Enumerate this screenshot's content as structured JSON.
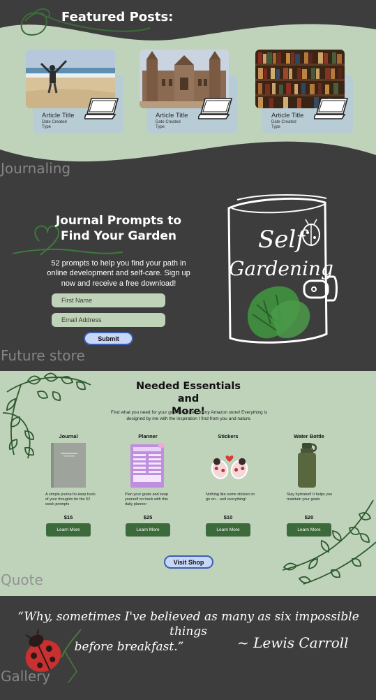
{
  "featured": {
    "title": "Featured Posts:",
    "posts": [
      {
        "title": "Article Title",
        "date": "Date Created",
        "type": "Type"
      },
      {
        "title": "Article Title",
        "date": "Date Created",
        "type": "Type"
      },
      {
        "title": "Article Title",
        "date": "Date Created",
        "type": "Type"
      }
    ]
  },
  "journaling": {
    "section_label": "Journaling",
    "title_line1": "Journal Prompts to",
    "title_line2": "Find Your Garden",
    "description": "52 prompts to help you find your path in online development and self-care. Sign up now and receive a free download!",
    "first_name_placeholder": "First Name",
    "email_placeholder": "Email Address",
    "submit_label": "Submit",
    "book_line1": "Self",
    "book_line2": "Gardening"
  },
  "store": {
    "section_label": "Future store",
    "title_line1": "Needed Essentials and",
    "title_line2": "More!",
    "description": "Find what you need for your growth located in my Amazon store! Everything is designed by me with the inspiration I find from you and nature.",
    "products": [
      {
        "name": "Journal",
        "description": "A simple journal to keep track of your thoughts for the 52 week prompts",
        "price": "$15",
        "button": "Learn More"
      },
      {
        "name": "Planner",
        "description": "Plan your goals and keep yourself on track with this daily planner",
        "price": "$25",
        "button": "Learn More"
      },
      {
        "name": "Stickers",
        "description": "Nothing like some stickers to go on... well everything!",
        "price": "$10",
        "button": "Learn More"
      },
      {
        "name": "Water Bottle",
        "description": "Stay hydrated! It helps you maintain your goals",
        "price": "$20",
        "button": "Learn More"
      }
    ],
    "visit_label": "Visit Shop"
  },
  "quote": {
    "section_label": "Quote",
    "text_line1": "“Why, sometimes I've believed as many as six impossible things",
    "text_line2": "before breakfast.”",
    "author": "~ Lewis Carroll"
  },
  "gallery": {
    "section_label": "Gallery"
  },
  "colors": {
    "sage": "#bfd3bb",
    "dark": "#3d3d3d",
    "forest": "#3d6a3a",
    "card_blue": "#b8ccd6",
    "button_blue": "#c8d6f8"
  }
}
